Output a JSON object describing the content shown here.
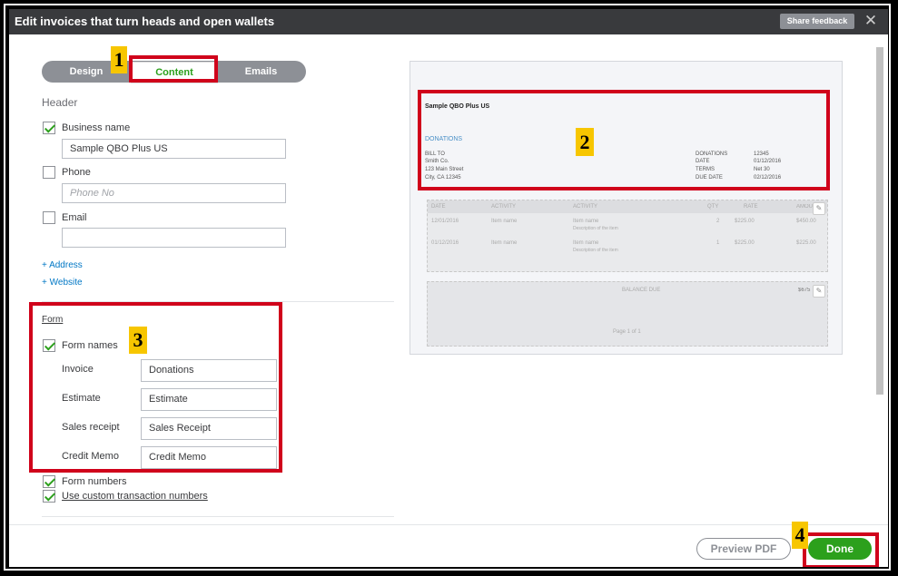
{
  "window": {
    "title": "Edit invoices that turn heads and open wallets",
    "share_feedback": "Share feedback",
    "close_glyph": "✕"
  },
  "tabs": [
    {
      "label": "Design"
    },
    {
      "label": "Content"
    },
    {
      "label": "Emails"
    }
  ],
  "header_section": {
    "title": "Header",
    "business_name": {
      "label": "Business name",
      "value": "Sample QBO Plus US"
    },
    "phone": {
      "label": "Phone",
      "placeholder": "Phone No"
    },
    "email": {
      "label": "Email",
      "value": ""
    },
    "add_address": "+ Address",
    "add_website": "+ Website"
  },
  "form_section": {
    "title": "Form",
    "form_names_label": "Form names",
    "rows": [
      {
        "label": "Invoice",
        "value": "Donations"
      },
      {
        "label": "Estimate",
        "value": "Estimate"
      },
      {
        "label": "Sales receipt",
        "value": "Sales Receipt"
      },
      {
        "label": "Credit Memo",
        "value": "Credit Memo"
      }
    ],
    "form_numbers_label": "Form numbers",
    "custom_numbers_label": "Use custom transaction numbers"
  },
  "preview": {
    "company": "Sample QBO Plus US",
    "doc_title": "DONATIONS",
    "bill_to_label": "BILL TO",
    "bill_to_lines": [
      "Smith Co.",
      "123 Main Street",
      "City, CA 12345"
    ],
    "meta_labels": [
      "DONATIONS",
      "DATE",
      "TERMS",
      "DUE DATE"
    ],
    "meta_values": [
      "12345",
      "01/12/2016",
      "Net 30",
      "02/12/2016"
    ],
    "columns": [
      "DATE",
      "ACTIVITY",
      "ACTIVITY",
      "QTY",
      "RATE",
      "AMOUNT"
    ],
    "lines": [
      {
        "date": "12/01/2016",
        "activity": "Item name",
        "name": "Item name",
        "desc": "Description of the item",
        "qty": "2",
        "rate": "$225.00",
        "amount": "$450.00"
      },
      {
        "date": "01/12/2016",
        "activity": "Item name",
        "name": "Item name",
        "desc": "Description of the item",
        "qty": "1",
        "rate": "$225.00",
        "amount": "$225.00"
      }
    ],
    "balance_due_label": "BALANCE DUE",
    "balance_due_value": "$675.00",
    "page_label": "Page 1 of 1"
  },
  "footer": {
    "preview_pdf": "Preview PDF",
    "done": "Done"
  },
  "callouts": [
    "1",
    "2",
    "3",
    "4"
  ],
  "colors": {
    "accent_green": "#2ca01c",
    "link_blue": "#0077c5",
    "callout_red": "#d0021b",
    "callout_badge": "#f7c600",
    "titlebar": "#393a3d"
  },
  "icons": [
    "check-icon",
    "pencil-icon",
    "close-icon"
  ]
}
